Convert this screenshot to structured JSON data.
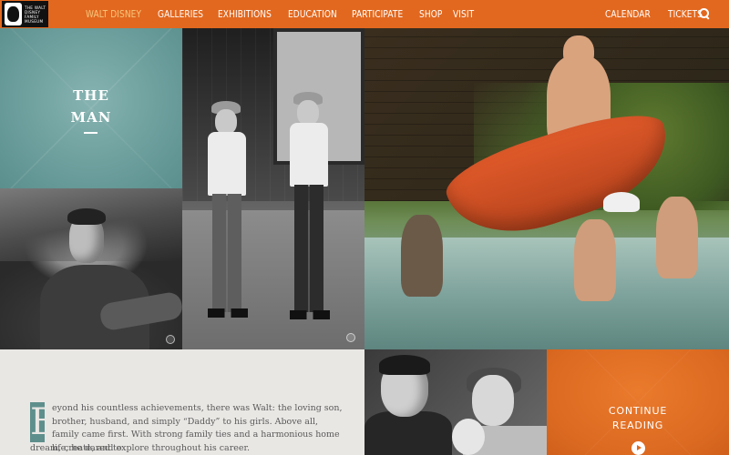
{
  "header": {
    "logo_lines": [
      "The Walt",
      "Disney",
      "Family",
      "Museum"
    ],
    "nav_main": [
      {
        "label": "Walt Disney",
        "active": true
      },
      {
        "label": "Galleries",
        "active": false
      },
      {
        "label": "Exhibitions",
        "active": false
      },
      {
        "label": "Education",
        "active": false
      },
      {
        "label": "Participate",
        "active": false
      },
      {
        "label": "Shop",
        "active": false
      },
      {
        "label": "Visit",
        "active": false
      }
    ],
    "nav_right": [
      {
        "label": "Calendar"
      },
      {
        "label": "Tickets"
      }
    ],
    "search_icon": "search-icon"
  },
  "hero": {
    "title_line1": "THE",
    "title_line2": "MAN"
  },
  "story": {
    "dropcap": "B",
    "first_lines": "eyond his countless achievements, there was Walt: the loving son, brother, husband, and simply “Daddy” to his girls. Above all, family came first. With strong family ties and a harmonious home life, he dared to",
    "last_line": "dream, create, and explore throughout his career."
  },
  "cta": {
    "line1": "Continue",
    "line2": "Reading",
    "icon": "play-icon"
  },
  "colors": {
    "nav_bg": "#e2681f",
    "nav_active": "#f7c77d",
    "teal_tile": "#6a9d9b",
    "orange_tile": "#dc6a21"
  }
}
